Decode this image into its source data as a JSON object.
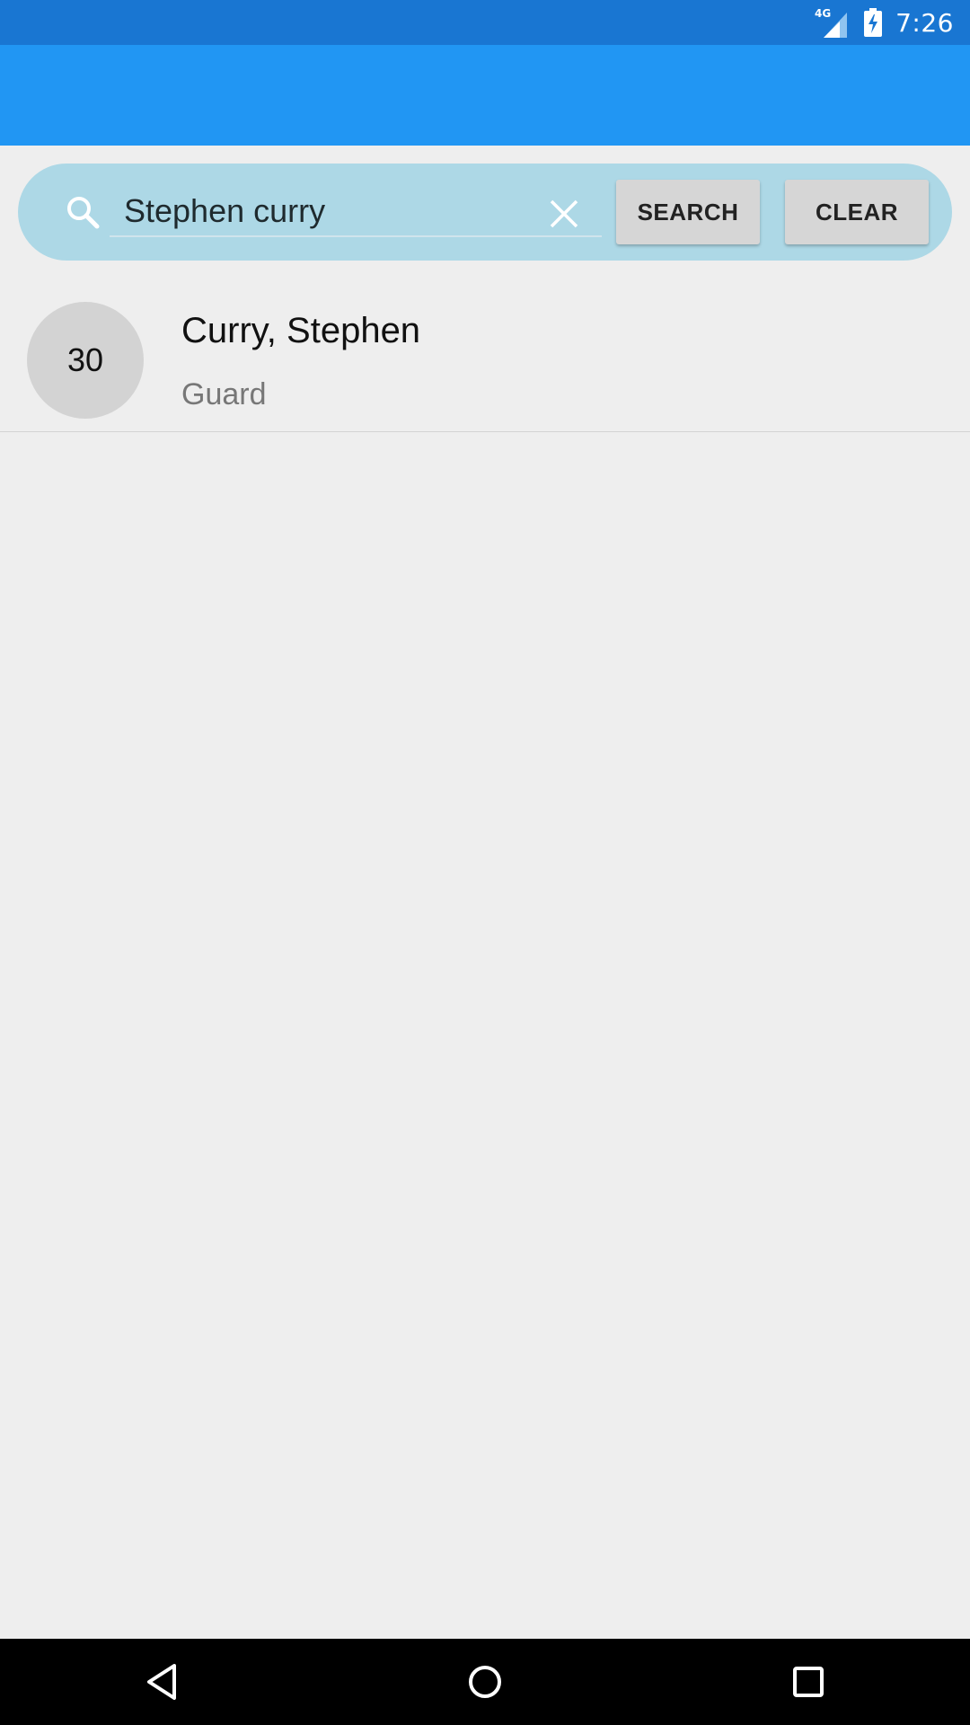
{
  "status_bar": {
    "network": "4G",
    "time": "7:26",
    "colors": {
      "background": "#1976d2"
    }
  },
  "app_bar": {
    "color": "#2196f3"
  },
  "search": {
    "value": "Stephen curry",
    "search_label": "SEARCH",
    "clear_label": "CLEAR",
    "panel_color": "#add8e6"
  },
  "results": [
    {
      "number": "30",
      "name": "Curry, Stephen",
      "position": "Guard"
    }
  ],
  "nav_bar": {
    "icons": [
      "back-icon",
      "home-icon",
      "recents-icon"
    ]
  }
}
